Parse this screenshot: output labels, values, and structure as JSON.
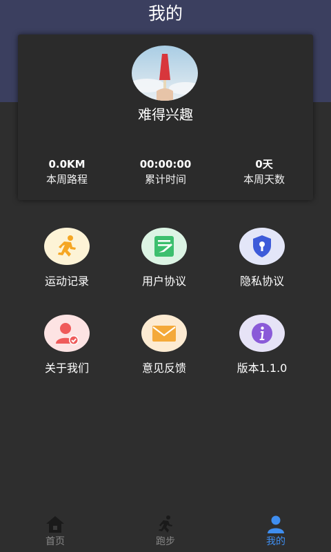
{
  "header": {
    "title": "我的"
  },
  "profile": {
    "nickname": "难得兴趣"
  },
  "stats": [
    {
      "value": "0.0KM",
      "label": "本周路程"
    },
    {
      "value": "00:00:00",
      "label": "累计时间"
    },
    {
      "value": "0天",
      "label": "本周天数"
    }
  ],
  "menu": [
    {
      "label": "运动记录",
      "icon": "running-person-icon",
      "bg": "#fdf3d6",
      "fg": "#f5a623"
    },
    {
      "label": "用户协议",
      "icon": "document-edit-icon",
      "bg": "#dcf4e4",
      "fg": "#3cbf6e"
    },
    {
      "label": "隐私协议",
      "icon": "shield-lock-icon",
      "bg": "#e3e6f8",
      "fg": "#3d5bd9"
    },
    {
      "label": "关于我们",
      "icon": "user-check-icon",
      "bg": "#fde3e3",
      "fg": "#ef5a5a"
    },
    {
      "label": "意见反馈",
      "icon": "envelope-icon",
      "bg": "#fdebd2",
      "fg": "#f4a93a"
    },
    {
      "label": "版本1.1.0",
      "icon": "info-icon",
      "bg": "#e6e3f6",
      "fg": "#8a5ad8"
    }
  ],
  "bottom_nav": [
    {
      "label": "首页",
      "icon": "home-icon",
      "active": false
    },
    {
      "label": "跑步",
      "icon": "runner-icon",
      "active": false
    },
    {
      "label": "我的",
      "icon": "user-icon",
      "active": true
    }
  ],
  "colors": {
    "header_bg": "#3b3f5f",
    "page_bg": "#2e2e2e",
    "card_bg": "#2b2b2b",
    "active_nav": "#3f8ef0",
    "inactive_nav": "#888888"
  }
}
